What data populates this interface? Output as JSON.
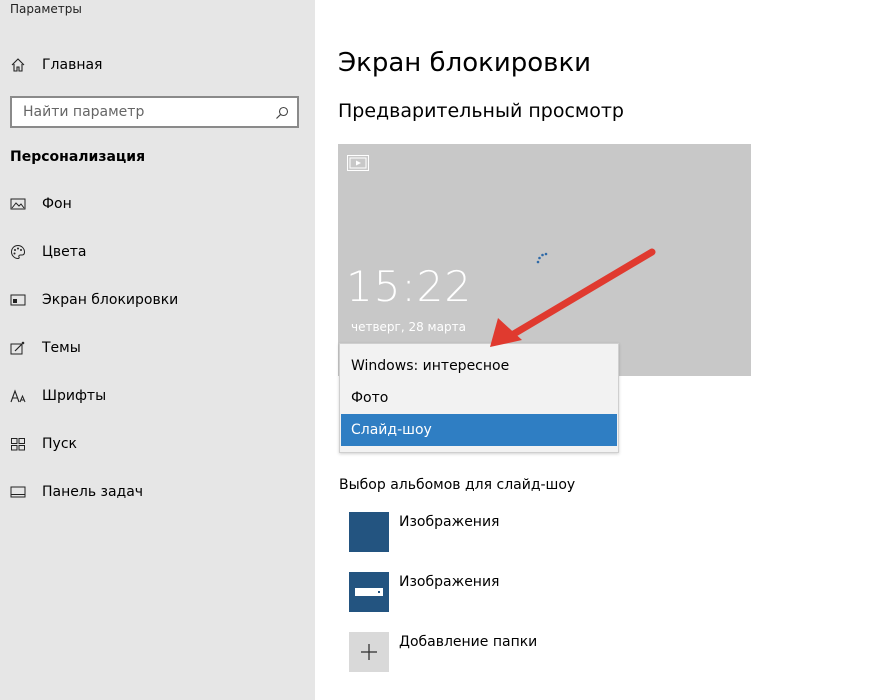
{
  "window": {
    "title": "Параметры"
  },
  "sidebar": {
    "home_label": "Главная",
    "search_placeholder": "Найти параметр",
    "section_heading": "Персонализация",
    "items": [
      {
        "label": "Фон",
        "icon": "picture-icon"
      },
      {
        "label": "Цвета",
        "icon": "palette-icon"
      },
      {
        "label": "Экран блокировки",
        "icon": "lock-screen-icon"
      },
      {
        "label": "Темы",
        "icon": "themes-icon"
      },
      {
        "label": "Шрифты",
        "icon": "fonts-icon"
      },
      {
        "label": "Пуск",
        "icon": "start-icon"
      },
      {
        "label": "Панель задач",
        "icon": "taskbar-icon"
      }
    ]
  },
  "main": {
    "title": "Экран блокировки",
    "preview_heading": "Предварительный просмотр",
    "preview": {
      "time": "15:22",
      "date": "четверг, 28 марта"
    },
    "dropdown": {
      "options": [
        "Windows: интересное",
        "Фото",
        "Слайд-шоу"
      ],
      "selected": "Слайд-шоу"
    },
    "albums_heading": "Выбор альбомов для слайд-шоу",
    "albums": [
      {
        "label": "Изображения"
      },
      {
        "label": "Изображения"
      }
    ],
    "add_folder_label": "Добавление папки"
  },
  "colors": {
    "sidebar_bg": "#e6e6e6",
    "preview_bg": "#c8c8c8",
    "accent": "#2f7ec3",
    "album_thumb": "#235480",
    "annotation_arrow": "#e03a2f"
  }
}
